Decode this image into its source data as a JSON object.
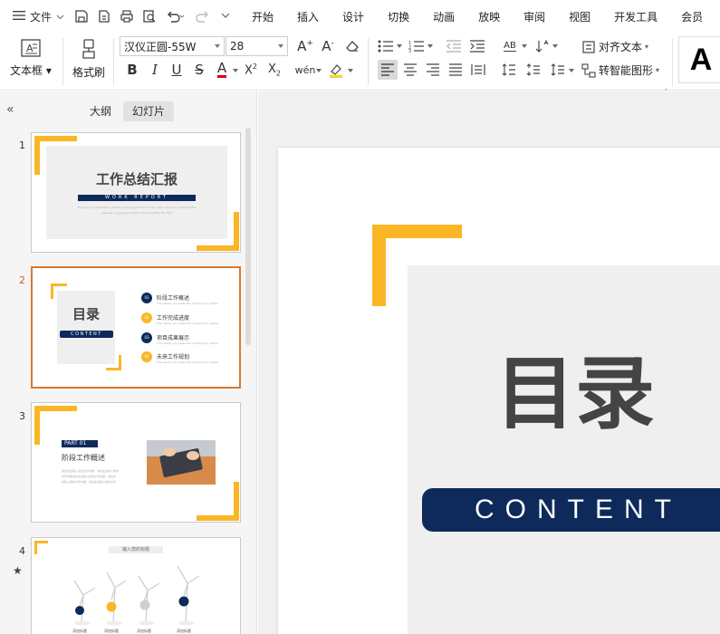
{
  "colors": {
    "accent": "#fbb626",
    "navy": "#0d2a5b",
    "selected_border": "#d8782f",
    "gray_box": "#efefef"
  },
  "menubar": {
    "menu_icon": "hamburger-icon",
    "file_label": "文件",
    "tabs": [
      "开始",
      "插入",
      "设计",
      "切换",
      "动画",
      "放映",
      "审阅",
      "视图",
      "开发工具",
      "会员"
    ]
  },
  "ribbon": {
    "textbox_label": "文本框",
    "format_painter_label": "格式刷",
    "font_name": "汉仪正圆-55W",
    "font_size": "28",
    "align_text_label": "对齐文本",
    "smartart_label": "转智能图形",
    "style_preview": "A"
  },
  "panel": {
    "outline_tab": "大纲",
    "slides_tab": "幻灯片",
    "slides": [
      {
        "number": "1",
        "title": "工作总结汇报",
        "subtitle": "WORK REPORT",
        "body_line1": "Type your content here, ideas by copying your text or by input. Type your content here",
        "body_line2": "ideas by copying your text or by input after the text"
      },
      {
        "number": "2",
        "toc_title": "目录",
        "toc_subtitle": "CONTENT",
        "items": [
          {
            "num": "01",
            "label": "阶段工作概述",
            "sub": "The reader you paste the content you realize"
          },
          {
            "num": "02",
            "label": "工作完成进度",
            "sub": "The reader you paste the content you realize"
          },
          {
            "num": "03",
            "label": "项目成果展示",
            "sub": "The reader you paste the content you realize"
          },
          {
            "num": "04",
            "label": "未来工作规划",
            "sub": "The reader you paste the content you realize"
          }
        ]
      },
      {
        "number": "3",
        "part": "PART 01",
        "title": "阶段工作概述",
        "body_line1": "请在此处输入您的文字内容，请在此处输入您的",
        "body_line2": "文字内容请在此处输入您的文字内容，请在此",
        "body_line3": "处输入您的文字内容，请在此处输入您的文字"
      },
      {
        "number": "4",
        "header": "输入您的标题",
        "labels": [
          "添加标题",
          "添加标题",
          "添加标题",
          "添加标题"
        ],
        "star": "★"
      }
    ]
  },
  "main_slide": {
    "title": "目录",
    "subtitle": "CONTENT"
  }
}
